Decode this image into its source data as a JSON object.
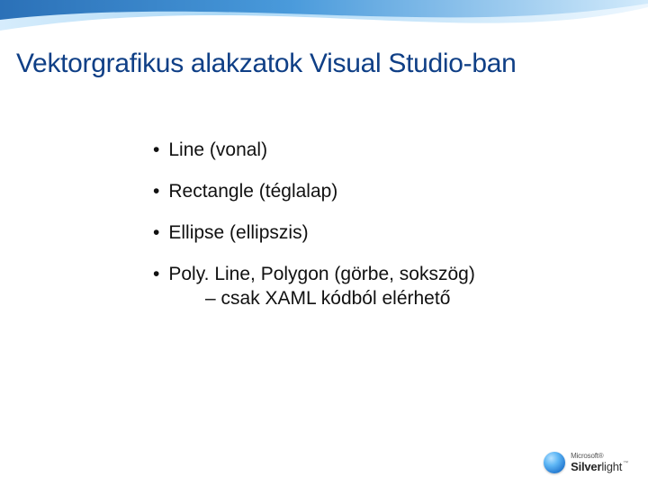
{
  "title": "Vektorgrafikus alakzatok Visual Studio-ban",
  "bullets": [
    {
      "text": "Line (vonal)"
    },
    {
      "text": "Rectangle (téglalap)"
    },
    {
      "text": "Ellipse (ellipszis)"
    },
    {
      "text": "Poly. Line, Polygon (görbe, sokszög)",
      "sub": "– csak XAML kódból elérhető"
    }
  ],
  "footer": {
    "ms": "Microsoft®",
    "sl_prefix": "Silver",
    "sl_suffix": "light",
    "tm": "™"
  }
}
